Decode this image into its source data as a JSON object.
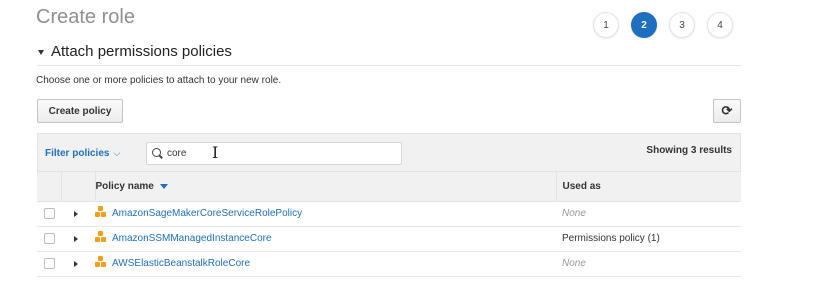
{
  "page": {
    "title": "Create role",
    "steps": [
      "1",
      "2",
      "3",
      "4"
    ],
    "active_step": "2"
  },
  "section": {
    "title": "Attach permissions policies",
    "description": "Choose one or more policies to attach to your new role."
  },
  "toolbar": {
    "create_policy_label": "Create policy",
    "refresh_icon": "refresh-icon"
  },
  "filter": {
    "label": "Filter policies",
    "search_value": "core",
    "results_text": "Showing 3 results"
  },
  "table": {
    "headers": {
      "policy_name": "Policy name",
      "used_as": "Used as"
    },
    "rows": [
      {
        "name": "AmazonSageMakerCoreServiceRolePolicy",
        "used_as": "None"
      },
      {
        "name": "AmazonSSMManagedInstanceCore",
        "used_as": "Permissions policy (1)"
      },
      {
        "name": "AWSElasticBeanstalkRoleCore",
        "used_as": "None"
      }
    ]
  },
  "colors": {
    "accent": "#1e6fc0",
    "policy_icon": "#f59e1b"
  }
}
